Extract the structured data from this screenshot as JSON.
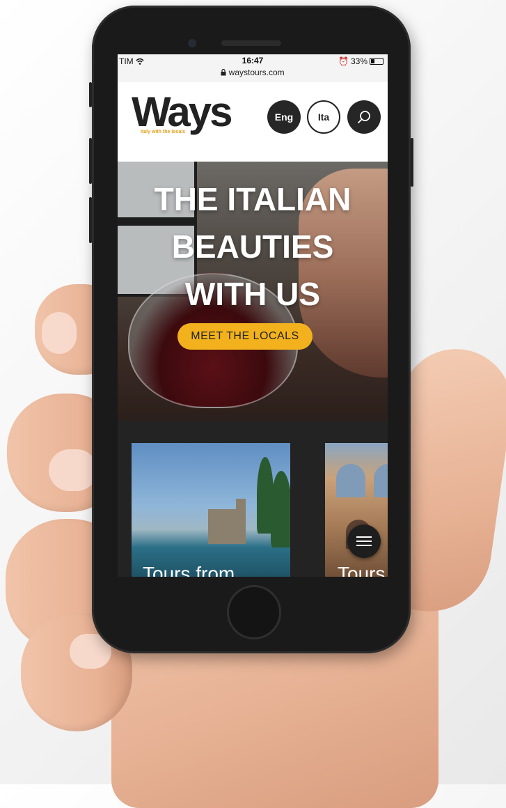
{
  "status_bar": {
    "carrier": "TIM",
    "time": "16:47",
    "url": "waystours.com",
    "battery": "33%"
  },
  "header": {
    "logo": "Ways",
    "tagline": "Italy with the locals",
    "lang_eng": "Eng",
    "lang_ita": "Ita",
    "search_icon": "search-icon"
  },
  "hero": {
    "title_lines": [
      "THE ITALIAN",
      "BEAUTIES",
      "WITH US"
    ],
    "cta": "MEET THE LOCALS"
  },
  "tours": {
    "cards": [
      {
        "title": "Tours from"
      },
      {
        "title": "Tours"
      }
    ]
  },
  "menu_icon": "hamburger-menu-icon",
  "colors": {
    "accent": "#f3b21d",
    "dark": "#262626",
    "section_bg": "#232323"
  }
}
